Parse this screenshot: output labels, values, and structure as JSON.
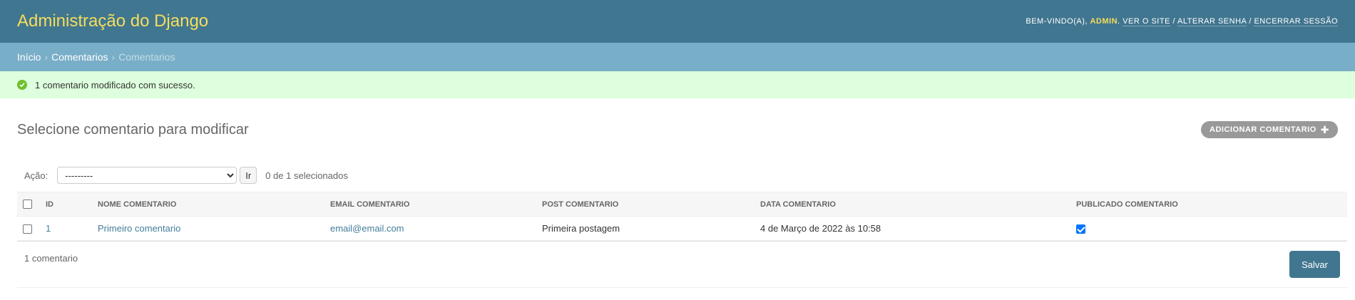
{
  "header": {
    "site_title": "Administração do Django",
    "welcome": "Bem-vindo(a),",
    "username": "admin",
    "links": {
      "view_site": "Ver o site",
      "change_password": "Alterar senha",
      "logout": "Encerrar sessão"
    },
    "separator": "/"
  },
  "breadcrumbs": {
    "home": "Início",
    "app": "Comentarios",
    "current": "Comentarios",
    "separator": "›"
  },
  "message": {
    "text": "1 comentario modificado com sucesso.",
    "icon": "check-circle-icon",
    "color": "#70bf2b"
  },
  "content": {
    "title": "Selecione comentario para modificar",
    "add_button": "Adicionar comentario",
    "add_icon": "plus-icon"
  },
  "actions": {
    "label": "Ação:",
    "selected_option": "---------",
    "go_button": "Ir",
    "counter": "0 de 1 selecionados"
  },
  "table": {
    "headers": {
      "id": "ID",
      "nome": "Nome comentario",
      "email": "Email comentario",
      "post": "Post comentario",
      "data": "Data comentario",
      "publicado": "Publicado comentario"
    },
    "rows": [
      {
        "id": "1",
        "nome": "Primeiro comentario",
        "email": "email@email.com",
        "post": "Primeira postagem",
        "data": "4 de Março de 2022 às 10:58",
        "publicado": true
      }
    ]
  },
  "paginator": {
    "count": "1 comentario",
    "save_button": "Salvar"
  },
  "colors": {
    "header_bg": "#417690",
    "title_yellow": "#f5dd5d",
    "breadcrumb_bg": "#79aec8",
    "success_bg": "#dfd",
    "link": "#447e9b"
  }
}
